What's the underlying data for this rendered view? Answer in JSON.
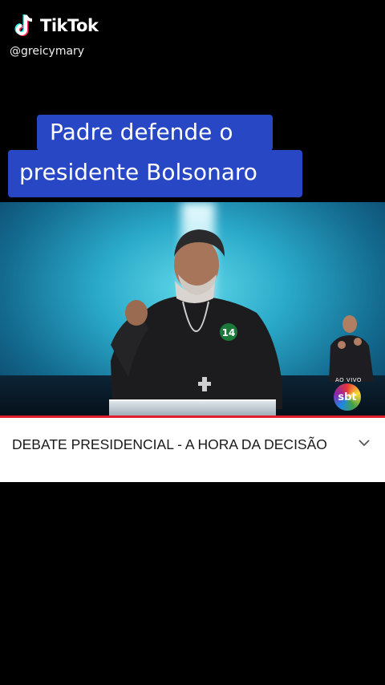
{
  "watermark": {
    "brand": "TikTok",
    "handle": "@greicymary",
    "icon": "tiktok-note-icon"
  },
  "caption": {
    "line1": "Padre defende o",
    "line2": "presidente Bolsonaro",
    "background": "#2747c4"
  },
  "video": {
    "badge_number": "14",
    "live_label": "AO VIVO",
    "channel_logo": "sbt"
  },
  "card": {
    "title": "DEBATE PRESIDENCIAL - A HORA DA DECISÃO",
    "expand_icon": "chevron-down-icon"
  },
  "colors": {
    "accent_red": "#e21b2d",
    "caption_blue": "#2747c4"
  }
}
